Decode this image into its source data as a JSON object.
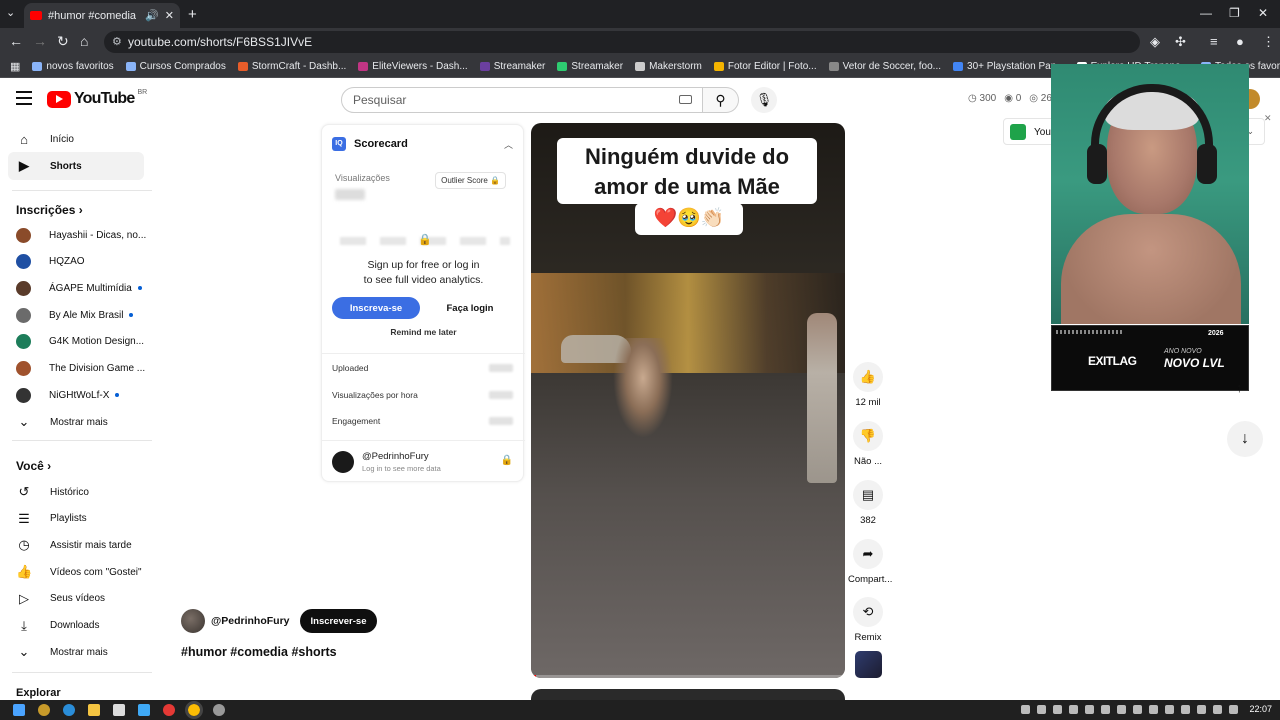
{
  "browser": {
    "tab_title": "#humor #comedia #shorts",
    "url": "youtube.com/shorts/F6BSS1JIVvE",
    "bookmarks": [
      "novos favoritos",
      "Cursos Comprados",
      "StormCraft - Dashb...",
      "EliteViewers - Dash...",
      "Streamaker",
      "Streamaker",
      "Makerstorm",
      "Fotor Editor | Foto...",
      "Vetor de Soccer, foo...",
      "30+ Playstation Pap...",
      "Explore HD Transpa...",
      "Todos os favoritos"
    ],
    "bookmark_colors": [
      "#8ab4f8",
      "#8ab4f8",
      "#e85d2a",
      "#c13584",
      "#6b3fa0",
      "#2ecc71",
      "#cccccc",
      "#f4b400",
      "#888888",
      "#4285f4",
      "#ffffff",
      "#8ab4f8"
    ]
  },
  "header": {
    "logo_text": "YouTube",
    "country": "BR",
    "search_placeholder": "Pesquisar",
    "stats": [
      "300",
      "0",
      "26"
    ]
  },
  "sidebar": {
    "main": [
      {
        "label": "Início",
        "icon": "home-icon"
      },
      {
        "label": "Shorts",
        "icon": "shorts-icon"
      }
    ],
    "subs_title": "Inscrições",
    "subs": [
      {
        "label": "Hayashii - Dicas, no...",
        "color": "#8a4b2a",
        "dot": false
      },
      {
        "label": "HQZAO",
        "color": "#1f4fa3",
        "dot": false
      },
      {
        "label": "ÁGAPE Multimídia",
        "color": "#5a3b2a",
        "dot": true
      },
      {
        "label": "By Ale Mix Brasil",
        "color": "#6b6b6b",
        "dot": true
      },
      {
        "label": "G4K Motion Design...",
        "color": "#1d7d5a",
        "dot": false
      },
      {
        "label": "The Division Game ...",
        "color": "#a0522d",
        "dot": false
      },
      {
        "label": "NiGHtWoLf-X",
        "color": "#333333",
        "dot": true
      }
    ],
    "show_more": "Mostrar mais",
    "you_title": "Você",
    "you_items": [
      {
        "label": "Histórico",
        "icon": "history-icon"
      },
      {
        "label": "Playlists",
        "icon": "playlists-icon"
      },
      {
        "label": "Assistir mais tarde",
        "icon": "watch-later-icon"
      },
      {
        "label": "Vídeos com \"Gostei\"",
        "icon": "like-icon"
      },
      {
        "label": "Seus vídeos",
        "icon": "your-videos-icon"
      },
      {
        "label": "Downloads",
        "icon": "download-icon"
      }
    ],
    "show_more2": "Mostrar mais",
    "explore_title": "Explorar"
  },
  "scorecard": {
    "title": "Scorecard",
    "views_label": "Visualizações",
    "outlier": "Outlier Score",
    "msg_line1": "Sign up for free or log in",
    "msg_line2": "to see full video analytics.",
    "signup": "Inscreva-se",
    "login": "Faça login",
    "remind": "Remind me later",
    "rows": [
      "Uploaded",
      "Visualizações por hora",
      "Engagement"
    ],
    "user_name": "@PedrinhoFury",
    "user_sub": "Log in to see more data"
  },
  "video": {
    "caption": "Ninguém duvide do amor de uma Mãe",
    "emoji": "❤️🥹👏🏻"
  },
  "actions": {
    "likes": "12 mil",
    "dislike": "Não ...",
    "comments": "382",
    "share": "Compart...",
    "remix": "Remix"
  },
  "channel": {
    "name": "@PedrinhoFury",
    "subscribe": "Inscrever-se",
    "title": "#humor #comedia #shorts"
  },
  "right": {
    "youbox": "You",
    "ad_brand": "EXITLAG",
    "ad_small": "ANO NOVO",
    "ad_big": "NOVO LVL",
    "ad_year": "2026"
  },
  "taskbar": {
    "time": "22:07"
  }
}
